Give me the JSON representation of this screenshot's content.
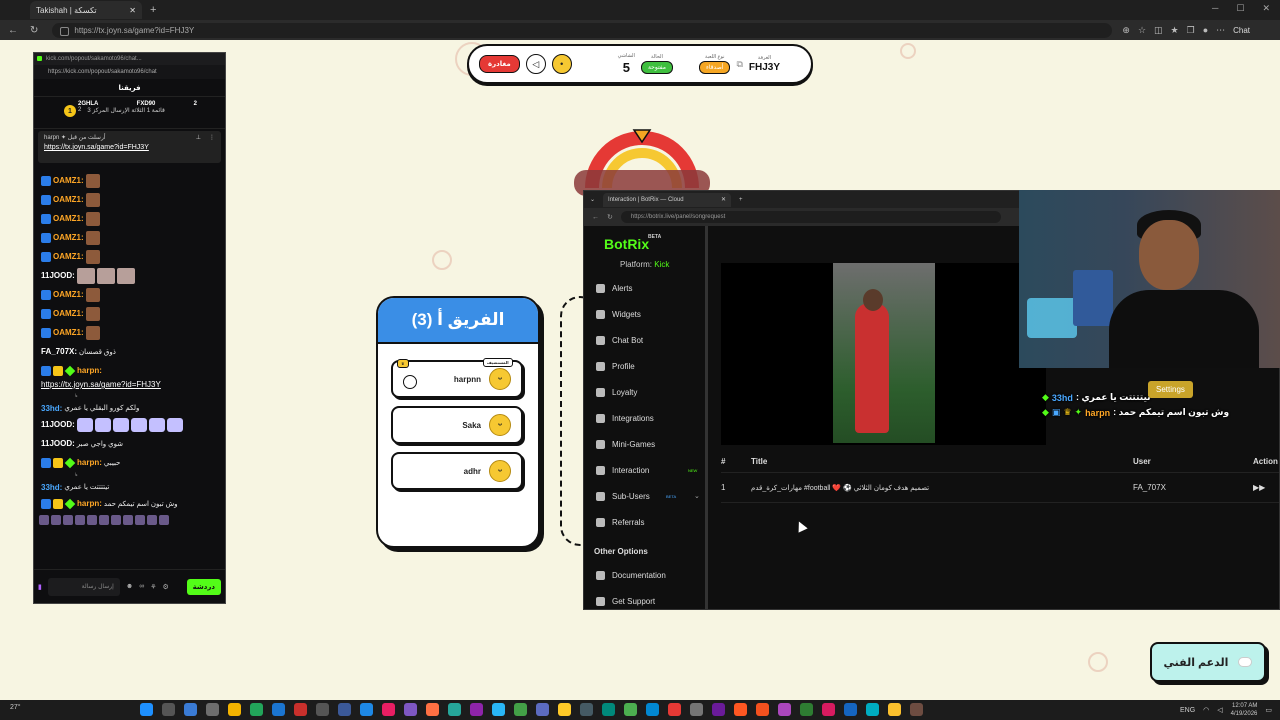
{
  "browser": {
    "tab_title": "Takishah | تكسكة",
    "url": "https://tx.joyn.sa/game?id=FHJ3Y",
    "chat_label": "Chat"
  },
  "game_header": {
    "leave_label": "مغادرة",
    "round_label": "الشاشي",
    "round_value": "5",
    "status_label": "الحالة",
    "status_value": "مفتوحة",
    "type_label": "نوع اللعبة",
    "type_value": "أصدقاء",
    "room_label": "الغرفة",
    "room_code": "FHJ3Y"
  },
  "team_card": {
    "title": "الفريق أ (3)",
    "players": [
      {
        "name": "harpnn",
        "badge": "المستضيف"
      },
      {
        "name": "Saka"
      },
      {
        "name": "adhr"
      }
    ]
  },
  "support": {
    "label": "الدعم الفني"
  },
  "kick": {
    "title_url": "kick.com/popout/sakamoto96/chat...",
    "url": "https://kick.com/popout/sakamoto96/chat",
    "header": "فريقنا",
    "scoreboard": {
      "left_name": "2GHLA",
      "left_count": "2",
      "right_name": "FXD90",
      "right_count": "2",
      "rank": "1",
      "line": "قائمة 1 الثلاثة الإرسال المركز 3"
    },
    "pinned": {
      "label": "harpn ✦ أرسلت من قبل",
      "link": "https://tx.joyn.sa/game?id=FHJ3Y"
    },
    "messages": [
      {
        "user": "OAMZ1:",
        "text": ""
      },
      {
        "user": "OAMZ1:",
        "text": ""
      },
      {
        "user": "OAMZ1:",
        "text": ""
      },
      {
        "user": "OAMZ1:",
        "text": ""
      },
      {
        "user": "OAMZ1:",
        "text": ""
      },
      {
        "user": "11JOOD:",
        "text": ""
      },
      {
        "user": "OAMZ1:",
        "text": ""
      },
      {
        "user": "OAMZ1:",
        "text": ""
      },
      {
        "user": "OAMZ1:",
        "text": ""
      },
      {
        "user": "FA_707X:",
        "text": "ذوق قصسان"
      },
      {
        "user": "harpn:",
        "text": ""
      },
      {
        "user": "33hd:",
        "text": "ولكم كورو البقلي يا عمري"
      },
      {
        "user": "11JOOD:",
        "text": ""
      },
      {
        "user": "11JOOD:",
        "text": "شوي واجي صبر"
      },
      {
        "user": "harpn:",
        "text": "حبيبي"
      },
      {
        "user": "33hd:",
        "text": "تيتتتتت يا عمري"
      },
      {
        "user": "harpn:",
        "text": "وش تبون اسم تيمكم حمد"
      }
    ],
    "harpn_link": "https://tx.joyn.sa/game?id=FHJ3Y",
    "input_placeholder": "إرسال رسالة",
    "send_label": "دردشة"
  },
  "botrix": {
    "tab_title": "Interaction | BotRix — Cloud",
    "url": "https://botrix.live/panel/songrequest",
    "logo": "BotRix",
    "beta": "BETA",
    "platform_label": "Platform:",
    "platform_value": "Kick",
    "menu": [
      "Alerts",
      "Widgets",
      "Chat Bot",
      "Profile",
      "Loyalty",
      "Integrations",
      "Mini-Games",
      "Interaction",
      "Sub-Users",
      "Referrals"
    ],
    "interaction_tag": "NEW",
    "subusers_tag": "BETA",
    "other_options": "Other Options",
    "menu2": [
      "Documentation",
      "Get Support"
    ],
    "table_headers": {
      "num": "#",
      "title": "Title",
      "user": "User",
      "action": "Action"
    },
    "rows": [
      {
        "num": "1",
        "title": "مهارات_كرة_قدم #football ❤️ ⚽ تصميم هدف كومان الثلاثي",
        "user": "FA_707X",
        "action": "▶▶"
      }
    ]
  },
  "overlay": {
    "msg1_user": "33hd",
    "msg1_text": ": تيتتتتت يا عمري",
    "msg2_user": "harpn",
    "msg2_text": ": وش تبون اسم تيمكم حمد",
    "settings_label": "Settings"
  },
  "taskbar": {
    "weather": "27°",
    "lang": "ENG",
    "time": "12:07 AM",
    "date": "4/19/2026"
  }
}
